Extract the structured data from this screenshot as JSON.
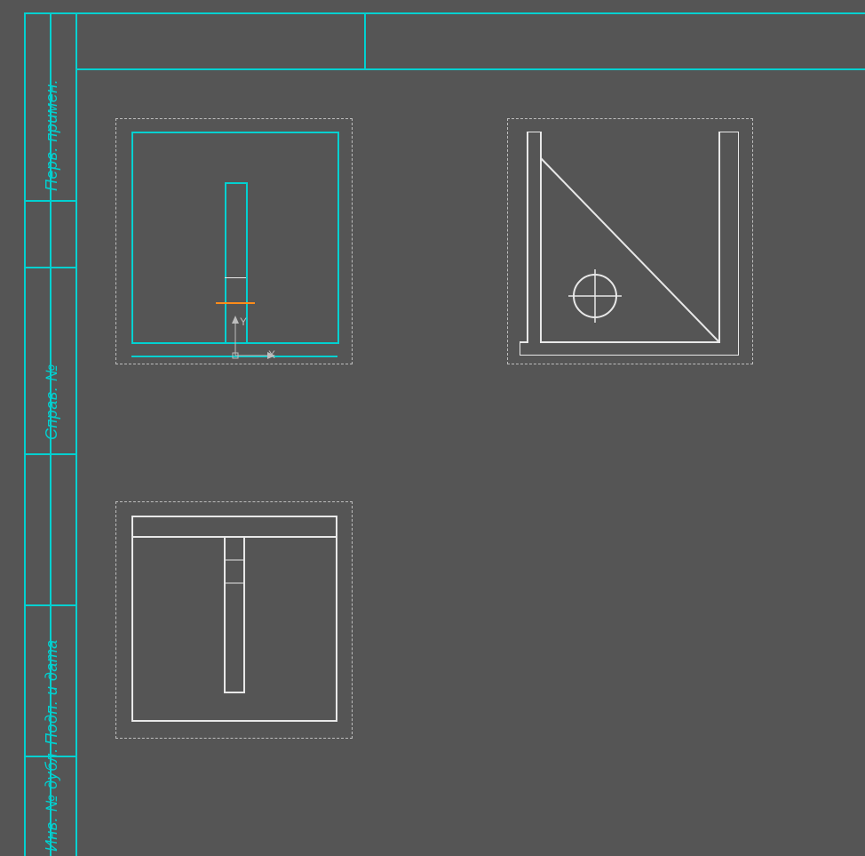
{
  "frame": {
    "color": "#00d0d0"
  },
  "sidebar": {
    "labels": [
      "Перв. примен.",
      "Справ. №",
      "Подп. и дата",
      "Инв. № дубл."
    ]
  },
  "views": {
    "top_left": {
      "selected": true,
      "outline_color": "#00d0d0",
      "marker_color": "#ff8c1a"
    },
    "top_right": {
      "outline_color": "#e8e8e8",
      "has_circle_target": true
    },
    "bottom_left": {
      "outline_color": "#e8e8e8"
    }
  },
  "origin": {
    "x_label": "X",
    "y_label": "Y"
  },
  "background": "#555555"
}
